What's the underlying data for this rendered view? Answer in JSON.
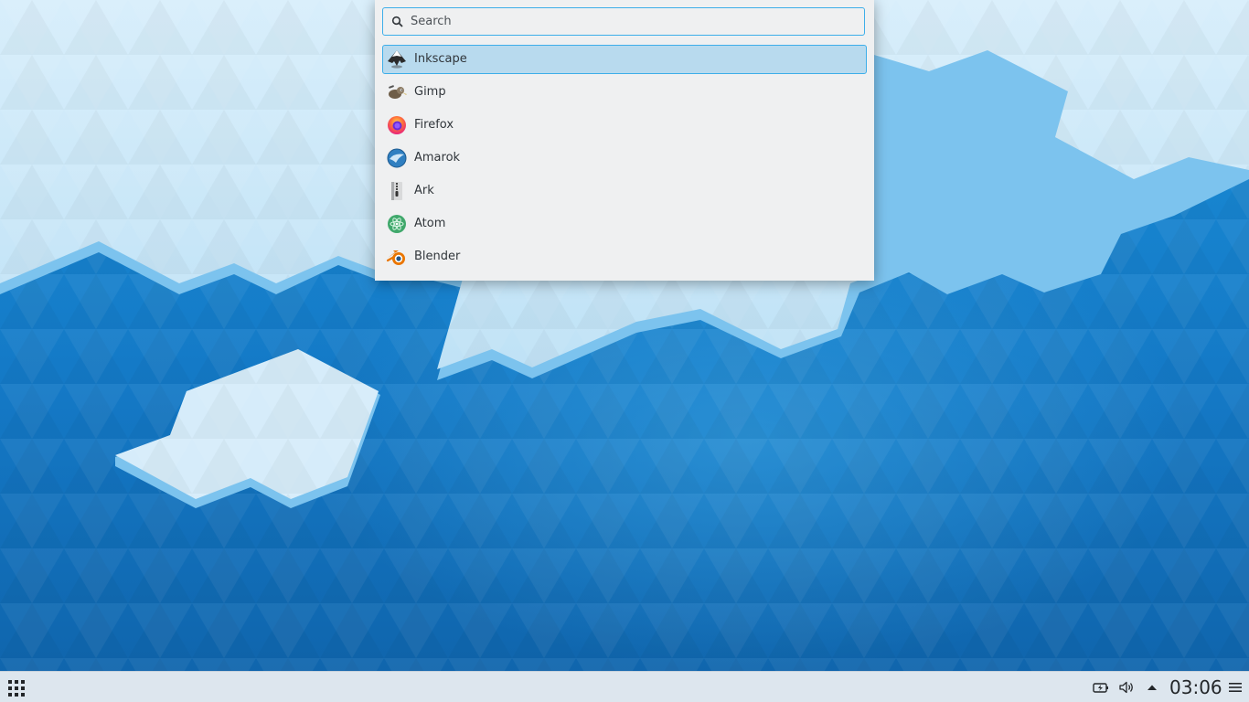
{
  "search": {
    "placeholder": "Search",
    "value": ""
  },
  "apps": [
    {
      "label": "Inkscape",
      "icon": "inkscape-icon",
      "selected": true
    },
    {
      "label": "Gimp",
      "icon": "gimp-icon",
      "selected": false
    },
    {
      "label": "Firefox",
      "icon": "firefox-icon",
      "selected": false
    },
    {
      "label": "Amarok",
      "icon": "amarok-icon",
      "selected": false
    },
    {
      "label": "Ark",
      "icon": "ark-icon",
      "selected": false
    },
    {
      "label": "Atom",
      "icon": "atom-icon",
      "selected": false
    },
    {
      "label": "Blender",
      "icon": "blender-icon",
      "selected": false
    }
  ],
  "taskbar": {
    "launcher_icon": "app-grid-icon",
    "tray": [
      "battery-charging-icon",
      "volume-icon",
      "tray-expand-icon",
      "hamburger-menu-icon"
    ],
    "clock": "03:06"
  },
  "colors": {
    "accent": "#3daee9",
    "selection": "#b8daee",
    "panel": "#dde6ee",
    "popup": "#eff0f1",
    "wallpaper_blue": "#1479c6"
  }
}
